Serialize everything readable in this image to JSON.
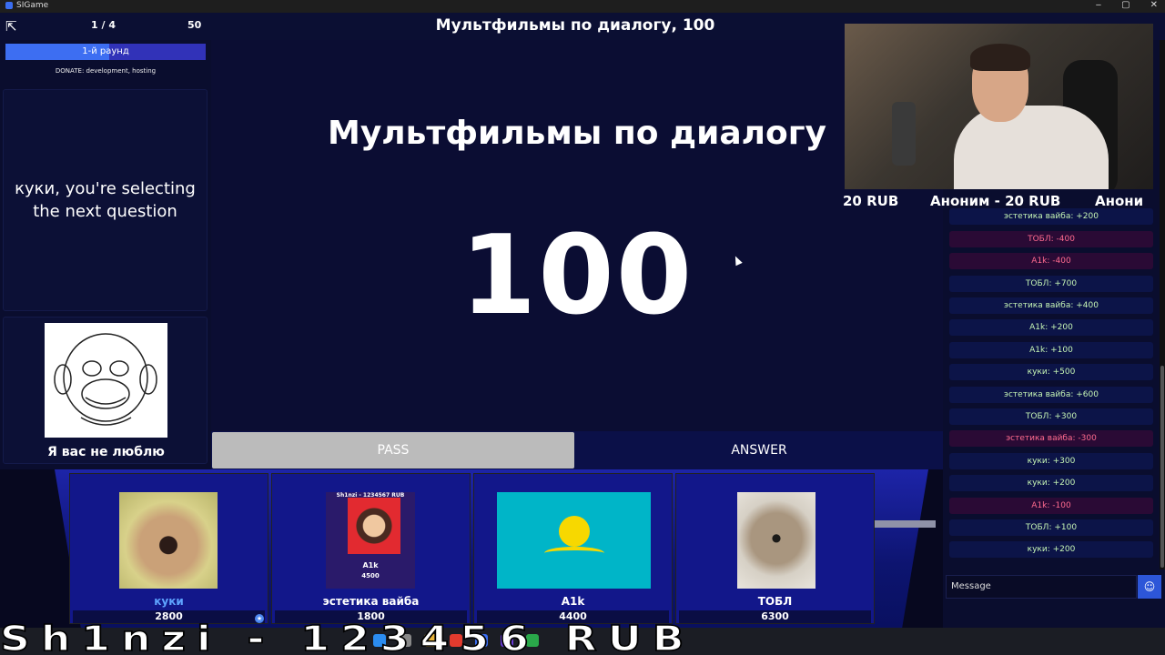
{
  "window": {
    "title": "SIGame",
    "controls": [
      "‒",
      "▢",
      "✕"
    ]
  },
  "topbar": {
    "round_counter": "1 / 4",
    "score": "50",
    "theme_price": "Мультфильмы по диалогу, 100"
  },
  "round": {
    "label": "1-й раунд",
    "progress": 0.52
  },
  "donate": "DONATE: development, hosting",
  "message": "куки, you're selecting the next question",
  "showman": {
    "name": "Я вас не люблю"
  },
  "board": {
    "theme": "Мультфильмы по диалогу",
    "price": "100"
  },
  "buttons": {
    "pass": "PASS",
    "answer": "ANSWER"
  },
  "players": [
    {
      "name": "куки",
      "score": "2800",
      "active": true
    },
    {
      "name": "эстетика вайба",
      "score": "1800",
      "avatar_header": "Sh1nzi - 1234567 RUB",
      "avatar_name": "A1k",
      "avatar_score": "4500"
    },
    {
      "name": "A1k",
      "score": "4400"
    },
    {
      "name": "ТОБЛ",
      "score": "6300"
    }
  ],
  "ticker": [
    "20 RUB",
    "Аноним - 20 RUB",
    "Анони"
  ],
  "feed": [
    {
      "text": "ТОБЛ: +300",
      "kind": "pos"
    },
    {
      "text": "эстетика вайба: +200",
      "kind": "pos"
    },
    {
      "text": "ТОБЛ: -400",
      "kind": "neg"
    },
    {
      "text": "A1k: -400",
      "kind": "neg"
    },
    {
      "text": "ТОБЛ: +700",
      "kind": "pos"
    },
    {
      "text": "эстетика вайба: +400",
      "kind": "pos"
    },
    {
      "text": "A1k: +200",
      "kind": "pos"
    },
    {
      "text": "A1k: +100",
      "kind": "pos"
    },
    {
      "text": "куки: +500",
      "kind": "pos"
    },
    {
      "text": "эстетика вайба: +600",
      "kind": "pos"
    },
    {
      "text": "ТОБЛ: +300",
      "kind": "pos"
    },
    {
      "text": "эстетика вайба: -300",
      "kind": "neg"
    },
    {
      "text": "куки: +300",
      "kind": "pos"
    },
    {
      "text": "куки: +200",
      "kind": "pos"
    },
    {
      "text": "A1k: -100",
      "kind": "neg"
    },
    {
      "text": "ТОБЛ: +100",
      "kind": "pos"
    },
    {
      "text": "куки: +200",
      "kind": "pos"
    }
  ],
  "chat": {
    "placeholder": "Message",
    "emoji_icon": "smile-icon"
  },
  "overlay": "Sh1nzi - 123456 RUB",
  "colors": {
    "accent": "#3d6ef2",
    "background": "#0a0d2e",
    "positive": "#c6f5b5",
    "negative": "#ff6b8f"
  }
}
